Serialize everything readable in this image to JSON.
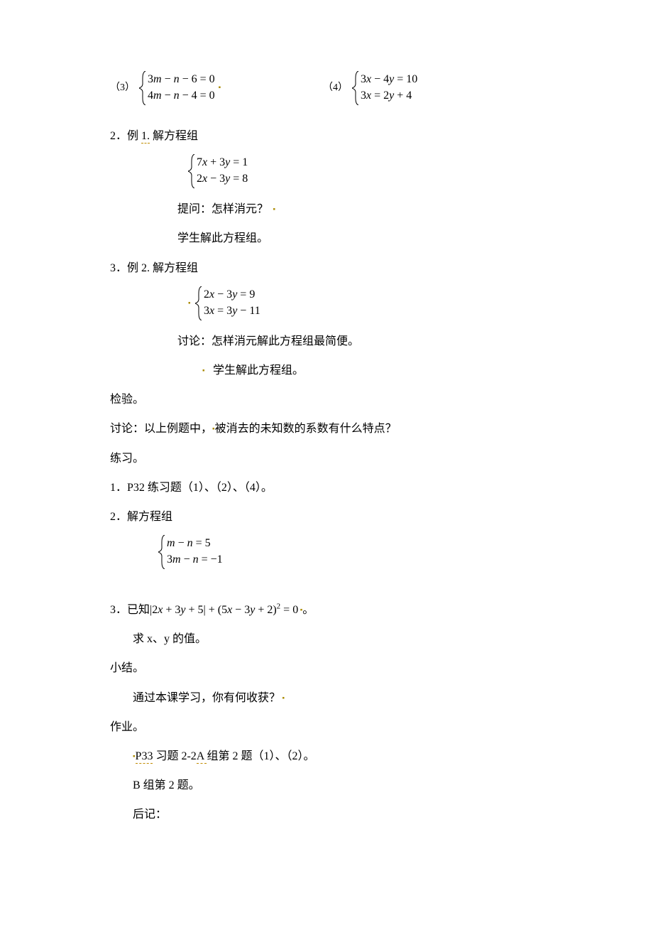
{
  "eq34": {
    "label3": "（3）",
    "sys3": {
      "r1": "3m − n − 6 = 0",
      "r2": "4m − n − 4 = 0"
    },
    "label4": "（4）",
    "sys4": {
      "r1": "3x − 4y = 10",
      "r2": "3x = 2y + 4"
    }
  },
  "sec2": {
    "head": "2．例 1. 解方程组",
    "sys": {
      "r1": "7x + 3y = 1",
      "r2": "2x − 3y = 8"
    },
    "q": "提问：怎样消元？",
    "s": "学生解此方程组。"
  },
  "sec3": {
    "head": "3．例 2. 解方程组",
    "sys": {
      "r1": "2x − 3y = 9",
      "r2": "3x = 3y − 11"
    },
    "d": "讨论：怎样消元解此方程组最简便。",
    "s": "学生解此方程组。"
  },
  "check": "检验。",
  "discuss": {
    "pre": "讨论：以上例题中，",
    "post": "被消去的未知数的系数有什么特点？"
  },
  "practice_head": "练习。",
  "p1": "1．P32 练习题（1）、（2）、（4）。",
  "p2": {
    "head": "2．解方程组",
    "sys": {
      "r1": "m − n = 5",
      "r2": "3m − n = −1"
    }
  },
  "p3": {
    "pre": "3．已知",
    "expr_abs": "|2x + 3y + 5|",
    "plus": " + ",
    "paren": "(5x − 3y + 2)",
    "sq": "2",
    "eq0": " = 0",
    "end": "。",
    "ask": "求 x、y 的值。"
  },
  "summary_head": "小结。",
  "summary_body": "通过本课学习，你有何收获？",
  "hw_head": "作业。",
  "hw1": {
    "pre": "P33 习题 2-2A 组第 2 题（1）、（2）。",
    "under": "P33"
  },
  "hw2": "B 组第 2 题。",
  "postscript": "后记："
}
